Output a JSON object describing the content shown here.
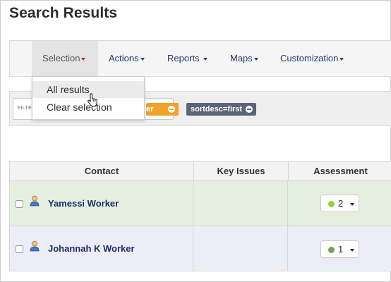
{
  "page": {
    "title": "Search Results"
  },
  "menubar": {
    "items": [
      {
        "label": "Selection",
        "active": true
      },
      {
        "label": "Actions"
      },
      {
        "label": "Reports"
      },
      {
        "label": "Maps"
      },
      {
        "label": "Customization"
      }
    ]
  },
  "dropdown": {
    "items": [
      "All results",
      "Clear selection"
    ]
  },
  "filters": {
    "label": "FILTE",
    "tags": [
      {
        "label": "er",
        "color": "#f0a22a"
      },
      {
        "label": "sortdesc=first",
        "color": "#5c6477"
      }
    ]
  },
  "table": {
    "columns": [
      "Contact",
      "Key Issues",
      "Assessment"
    ],
    "rows": [
      {
        "name": "Yamessi Worker",
        "key_issues": "",
        "assessment": "2",
        "dot_color": "#8fd13a",
        "row_color": "#e4efe0"
      },
      {
        "name": "Johannah K Worker",
        "key_issues": "",
        "assessment": "1",
        "dot_color": "#6ea45a",
        "row_color": "#ecedf7"
      }
    ]
  },
  "colors": {
    "accent_red": "#b3262a",
    "link_navy": "#1e2f63"
  }
}
